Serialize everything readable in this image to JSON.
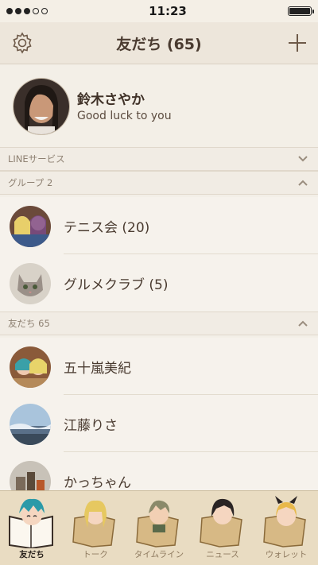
{
  "status": {
    "time": "11:23"
  },
  "header": {
    "title": "友だち (65)"
  },
  "profile": {
    "name": "鈴木さやか",
    "message": "Good luck to you"
  },
  "sections": {
    "line_services": "LINEサービス",
    "groups": "グループ 2",
    "friends": "友だち 65"
  },
  "groups": [
    {
      "label": "テニス会 (20)"
    },
    {
      "label": "グルメクラブ (5)"
    }
  ],
  "friends": [
    {
      "label": "五十嵐美紀"
    },
    {
      "label": "江藤りさ"
    },
    {
      "label": "かっちゃん"
    }
  ],
  "tabs": [
    {
      "label": "友だち",
      "active": true
    },
    {
      "label": "トーク"
    },
    {
      "label": "タイムライン"
    },
    {
      "label": "ニュース"
    },
    {
      "label": "ウォレット"
    }
  ],
  "colors": {
    "background": "#f3efe7",
    "header": "#ede6db",
    "tabbar": "#e9dcc2",
    "text": "#4a3b30"
  }
}
